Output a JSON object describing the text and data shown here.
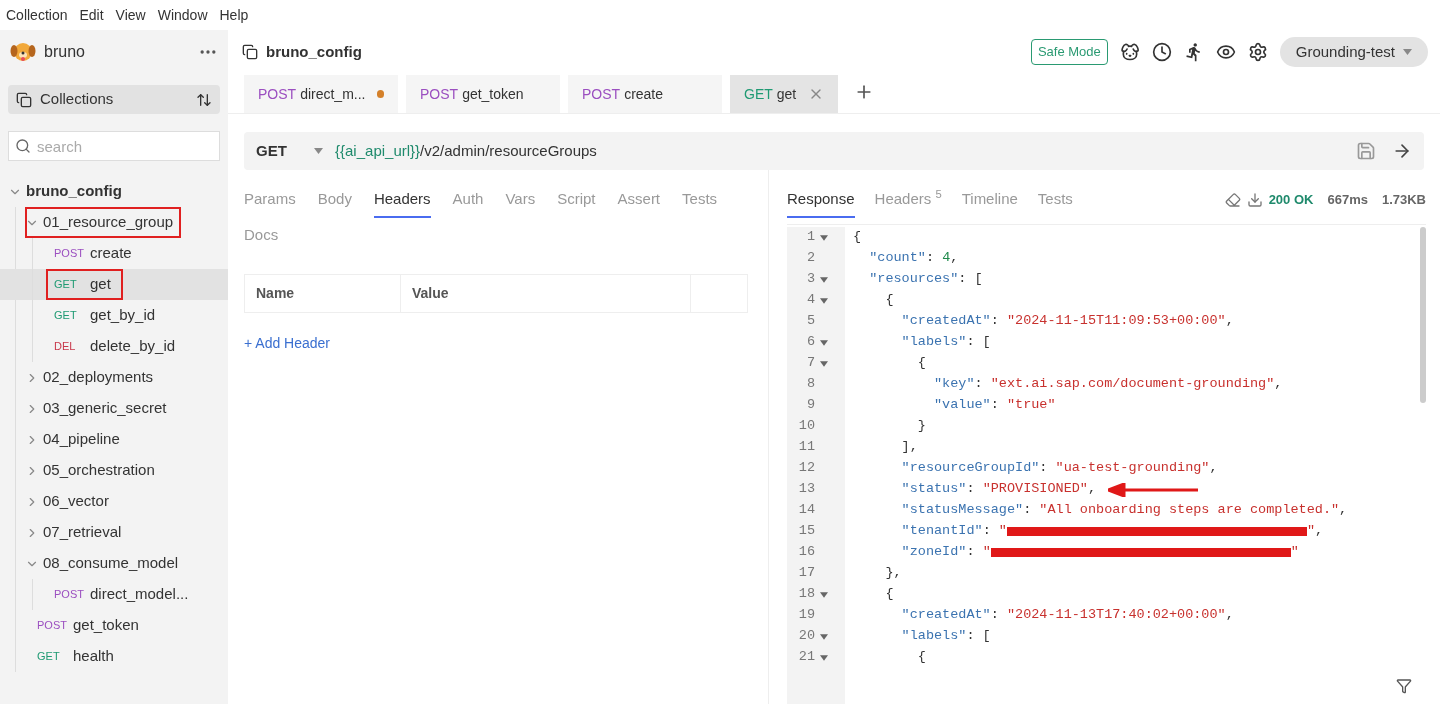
{
  "menu": [
    "Collection",
    "Edit",
    "View",
    "Window",
    "Help"
  ],
  "sidebar": {
    "app_name": "bruno",
    "collections_label": "Collections",
    "search": {
      "placeholder": "search"
    },
    "tree": [
      {
        "kind": "folder",
        "name": "bruno_config",
        "expanded": true,
        "selected": false,
        "highlighted": false,
        "children": [
          {
            "kind": "folder",
            "name": "01_resource_group",
            "expanded": true,
            "selected": false,
            "highlighted": true,
            "children": [
              {
                "kind": "request",
                "method": "POST",
                "color": "#9b4fc0",
                "name": "create",
                "selected": false,
                "highlighted": false
              },
              {
                "kind": "request",
                "method": "GET",
                "color": "#1f9a73",
                "name": "get",
                "selected": true,
                "highlighted": true
              },
              {
                "kind": "request",
                "method": "GET",
                "color": "#1f9a73",
                "name": "get_by_id",
                "selected": false,
                "highlighted": false
              },
              {
                "kind": "request",
                "method": "DEL",
                "color": "#c8374a",
                "name": "delete_by_id",
                "selected": false,
                "highlighted": false
              }
            ]
          },
          {
            "kind": "folder",
            "name": "02_deployments",
            "expanded": false,
            "selected": false,
            "highlighted": false
          },
          {
            "kind": "folder",
            "name": "03_generic_secret",
            "expanded": false,
            "selected": false,
            "highlighted": false
          },
          {
            "kind": "folder",
            "name": "04_pipeline",
            "expanded": false,
            "selected": false,
            "highlighted": false
          },
          {
            "kind": "folder",
            "name": "05_orchestration",
            "expanded": false,
            "selected": false,
            "highlighted": false
          },
          {
            "kind": "folder",
            "name": "06_vector",
            "expanded": false,
            "selected": false,
            "highlighted": false
          },
          {
            "kind": "folder",
            "name": "07_retrieval",
            "expanded": false,
            "selected": false,
            "highlighted": false
          },
          {
            "kind": "folder",
            "name": "08_consume_model",
            "expanded": true,
            "selected": false,
            "highlighted": false,
            "children": [
              {
                "kind": "request",
                "method": "POST",
                "color": "#9b4fc0",
                "name": "direct_model...",
                "selected": false,
                "highlighted": false
              }
            ]
          },
          {
            "kind": "request",
            "method": "POST",
            "color": "#9b4fc0",
            "name": "get_token",
            "selected": false,
            "highlighted": false
          },
          {
            "kind": "request",
            "method": "GET",
            "color": "#1f9a73",
            "name": "health",
            "selected": false,
            "highlighted": false
          }
        ]
      }
    ]
  },
  "header": {
    "collection": "bruno_config",
    "safe_mode": "Safe Mode",
    "environment": "Grounding-test"
  },
  "request_tabs": [
    {
      "method": "POST",
      "color": "#9b4fc0",
      "name": "direct_m...",
      "selected": false,
      "unsaved": true
    },
    {
      "method": "POST",
      "color": "#9b4fc0",
      "name": "get_token",
      "selected": false,
      "unsaved": false
    },
    {
      "method": "POST",
      "color": "#9b4fc0",
      "name": "create",
      "selected": false,
      "unsaved": false
    },
    {
      "method": "GET",
      "color": "#1f9a73",
      "name": "get",
      "selected": true,
      "unsaved": false
    }
  ],
  "url_bar": {
    "method": "GET",
    "variable": "{{ai_api_url}}",
    "path": "/v2/admin/resourceGroups"
  },
  "request_pane": {
    "tabs": [
      {
        "label": "Params",
        "selected": false
      },
      {
        "label": "Body",
        "selected": false
      },
      {
        "label": "Headers",
        "selected": true
      },
      {
        "label": "Auth",
        "selected": false
      },
      {
        "label": "Vars",
        "selected": false
      },
      {
        "label": "Script",
        "selected": false
      },
      {
        "label": "Assert",
        "selected": false
      },
      {
        "label": "Tests",
        "selected": false
      },
      {
        "label": "Docs",
        "selected": false
      }
    ],
    "table": {
      "columns": [
        "Name",
        "Value"
      ]
    },
    "add_link": "+ Add Header"
  },
  "response_pane": {
    "tabs": [
      {
        "label": "Response",
        "selected": true
      },
      {
        "label": "Headers $^{5}$",
        "selected": false
      },
      {
        "label": "Timeline",
        "selected": false
      },
      {
        "label": "Tests",
        "selected": false
      }
    ],
    "status": "200 OK",
    "time": "667ms",
    "size": "1.73KB",
    "lines": [
      {
        "n": "1",
        "fold": true,
        "tokens": [
          {
            "kind": "punct",
            "text": "{"
          }
        ]
      },
      {
        "n": "2",
        "fold": false,
        "tokens": [
          {
            "kind": "key",
            "text": "  \"count\""
          },
          {
            "kind": "punct",
            "text": ": "
          },
          {
            "kind": "num",
            "text": "4"
          },
          {
            "kind": "punct",
            "text": ","
          }
        ]
      },
      {
        "n": "3",
        "fold": true,
        "tokens": [
          {
            "kind": "key",
            "text": "  \"resources\""
          },
          {
            "kind": "punct",
            "text": ": ["
          }
        ]
      },
      {
        "n": "4",
        "fold": true,
        "tokens": [
          {
            "kind": "punct",
            "text": "    {"
          }
        ]
      },
      {
        "n": "5",
        "fold": false,
        "tokens": [
          {
            "kind": "key",
            "text": "      \"createdAt\""
          },
          {
            "kind": "punct",
            "text": ": "
          },
          {
            "kind": "str",
            "text": "\"2024-11-15T11:09:53+00:00\""
          },
          {
            "kind": "punct",
            "text": ","
          }
        ]
      },
      {
        "n": "6",
        "fold": true,
        "tokens": [
          {
            "kind": "key",
            "text": "      \"labels\""
          },
          {
            "kind": "punct",
            "text": ": ["
          }
        ]
      },
      {
        "n": "7",
        "fold": true,
        "tokens": [
          {
            "kind": "punct",
            "text": "        {"
          }
        ]
      },
      {
        "n": "8",
        "fold": false,
        "tokens": [
          {
            "kind": "key",
            "text": "          \"key\""
          },
          {
            "kind": "punct",
            "text": ": "
          },
          {
            "kind": "str",
            "text": "\"ext.ai.sap.com/document-grounding\""
          },
          {
            "kind": "punct",
            "text": ","
          }
        ]
      },
      {
        "n": "9",
        "fold": false,
        "tokens": [
          {
            "kind": "key",
            "text": "          \"value\""
          },
          {
            "kind": "punct",
            "text": ": "
          },
          {
            "kind": "str",
            "text": "\"true\""
          }
        ]
      },
      {
        "n": "10",
        "fold": false,
        "tokens": [
          {
            "kind": "punct",
            "text": "        }"
          }
        ]
      },
      {
        "n": "11",
        "fold": false,
        "tokens": [
          {
            "kind": "punct",
            "text": "      ],"
          }
        ]
      },
      {
        "n": "12",
        "fold": false,
        "tokens": [
          {
            "kind": "key",
            "text": "      \"resourceGroupId\""
          },
          {
            "kind": "punct",
            "text": ": "
          },
          {
            "kind": "str",
            "text": "\"ua-test-grounding\""
          },
          {
            "kind": "punct",
            "text": ","
          }
        ]
      },
      {
        "n": "13",
        "fold": false,
        "arrow": true,
        "tokens": [
          {
            "kind": "key",
            "text": "      \"status\""
          },
          {
            "kind": "punct",
            "text": ": "
          },
          {
            "kind": "str",
            "text": "\"PROVISIONED\""
          },
          {
            "kind": "punct",
            "text": ","
          }
        ]
      },
      {
        "n": "14",
        "fold": false,
        "tokens": [
          {
            "kind": "key",
            "text": "      \"statusMessage\""
          },
          {
            "kind": "punct",
            "text": ": "
          },
          {
            "kind": "str",
            "text": "\"All onboarding steps are completed.\""
          },
          {
            "kind": "punct",
            "text": ","
          }
        ]
      },
      {
        "n": "15",
        "fold": false,
        "tokens": [
          {
            "kind": "key",
            "text": "      \"tenantId\""
          },
          {
            "kind": "punct",
            "text": ": "
          },
          {
            "kind": "str",
            "text": "\""
          },
          {
            "kind": "redacted"
          },
          {
            "kind": "str",
            "text": "\""
          },
          {
            "kind": "punct",
            "text": ","
          }
        ]
      },
      {
        "n": "16",
        "fold": false,
        "tokens": [
          {
            "kind": "key",
            "text": "      \"zoneId\""
          },
          {
            "kind": "punct",
            "text": ": "
          },
          {
            "kind": "str",
            "text": "\""
          },
          {
            "kind": "redacted"
          },
          {
            "kind": "str",
            "text": "\""
          }
        ]
      },
      {
        "n": "17",
        "fold": false,
        "tokens": [
          {
            "kind": "punct",
            "text": "    },"
          }
        ]
      },
      {
        "n": "18",
        "fold": true,
        "tokens": [
          {
            "kind": "punct",
            "text": "    {"
          }
        ]
      },
      {
        "n": "19",
        "fold": false,
        "tokens": [
          {
            "kind": "key",
            "text": "      \"createdAt\""
          },
          {
            "kind": "punct",
            "text": ": "
          },
          {
            "kind": "str",
            "text": "\"2024-11-13T17:40:02+00:00\""
          },
          {
            "kind": "punct",
            "text": ","
          }
        ]
      },
      {
        "n": "20",
        "fold": true,
        "tokens": [
          {
            "kind": "key",
            "text": "      \"labels\""
          },
          {
            "kind": "punct",
            "text": ": ["
          }
        ]
      },
      {
        "n": "21",
        "fold": true,
        "tokens": [
          {
            "kind": "punct",
            "text": "        {"
          }
        ]
      }
    ]
  }
}
